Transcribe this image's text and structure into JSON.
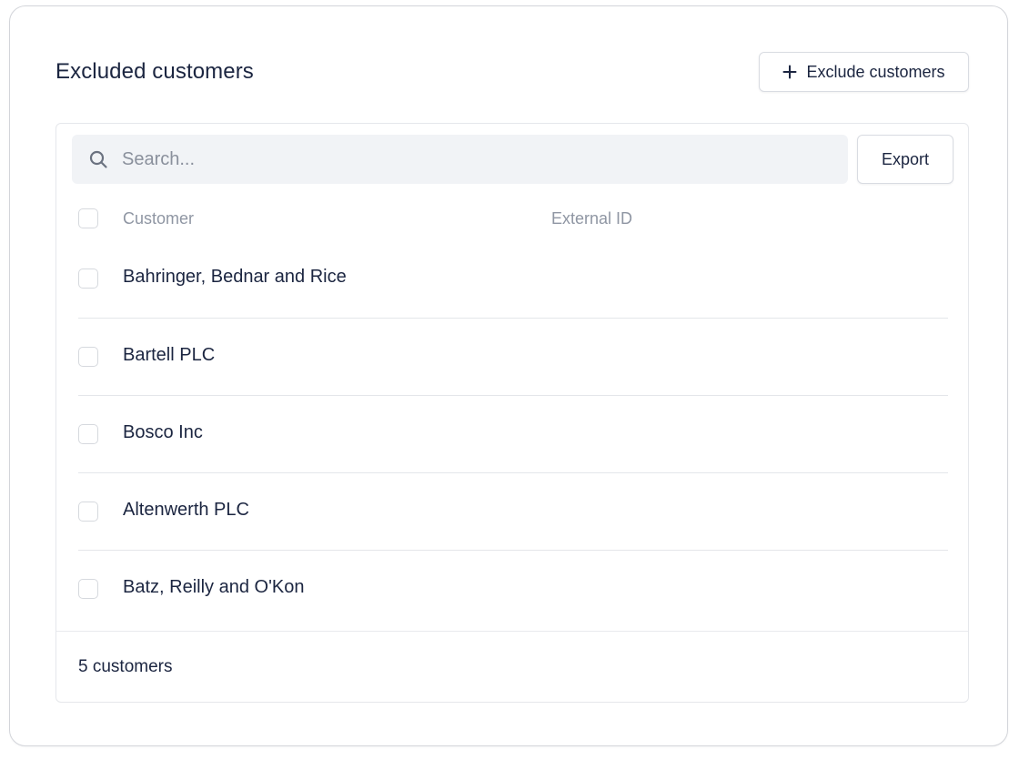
{
  "header": {
    "title": "Excluded customers",
    "exclude_button_label": "Exclude customers",
    "exclude_button_icon": "plus-icon"
  },
  "toolbar": {
    "search_placeholder": "Search...",
    "search_value": "",
    "export_label": "Export"
  },
  "table": {
    "columns": [
      "Customer",
      "External ID"
    ],
    "rows": [
      {
        "customer": "Bahringer, Bednar and Rice",
        "external_id": "",
        "selected": false
      },
      {
        "customer": "Bartell PLC",
        "external_id": "",
        "selected": false
      },
      {
        "customer": "Bosco Inc",
        "external_id": "",
        "selected": false
      },
      {
        "customer": "Altenwerth PLC",
        "external_id": "",
        "selected": false
      },
      {
        "customer": "Batz, Reilly and O'Kon",
        "external_id": "",
        "selected": false
      }
    ]
  },
  "footer": {
    "count_label": "5 customers"
  },
  "colors": {
    "text_primary": "#1b2540",
    "text_muted": "#8f96a3",
    "border": "#d3d5da",
    "search_bg": "#f1f3f6"
  }
}
